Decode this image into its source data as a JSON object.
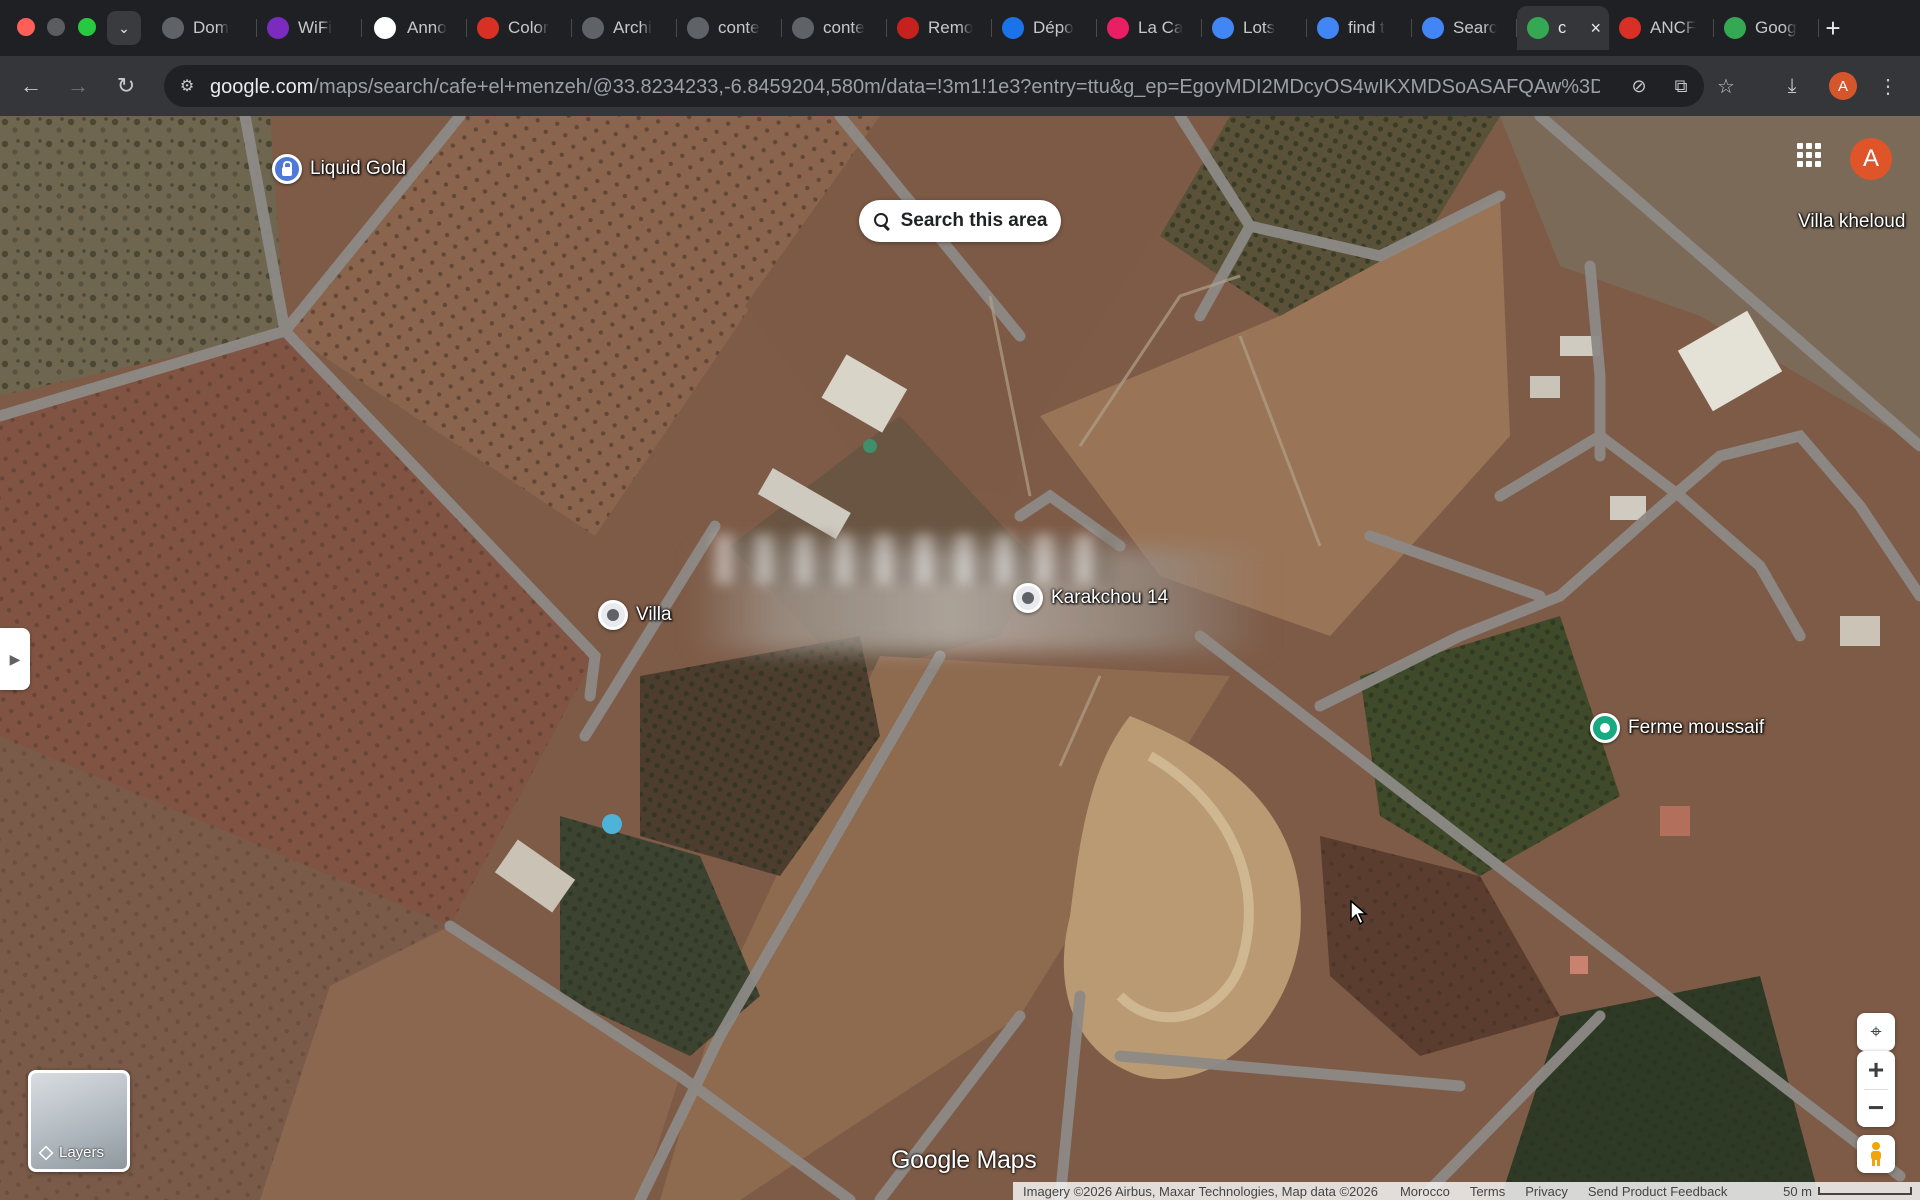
{
  "browser": {
    "tabs": [
      {
        "title": "Dom",
        "icon": "globe-icon",
        "color": "#5f6368"
      },
      {
        "title": "WiFi",
        "icon": "wifi-app-icon",
        "color": "#7b2cbf"
      },
      {
        "title": "Anno",
        "icon": "openai-icon",
        "color": "#ffffff"
      },
      {
        "title": "Color",
        "icon": "color-app-icon",
        "color": "#d93025"
      },
      {
        "title": "Archi",
        "icon": "archi-icon",
        "color": "#5f6368"
      },
      {
        "title": "conte",
        "icon": "globe-icon",
        "color": "#5f6368"
      },
      {
        "title": "conte",
        "icon": "globe-icon",
        "color": "#5f6368"
      },
      {
        "title": "Remo",
        "icon": "remove-bg-icon",
        "color": "#c5221f"
      },
      {
        "title": "Dépo",
        "icon": "cube-icon",
        "color": "#1a73e8"
      },
      {
        "title": "La Ca",
        "icon": "shape-icon",
        "color": "#e91e63"
      },
      {
        "title": "Lots",
        "icon": "google-icon",
        "color": "#4285f4"
      },
      {
        "title": "find t",
        "icon": "google-icon",
        "color": "#4285f4"
      },
      {
        "title": "Searc",
        "icon": "google-icon",
        "color": "#4285f4"
      },
      {
        "title": "c",
        "icon": "maps-pin-icon",
        "color": "#34a853",
        "active": true
      },
      {
        "title": "ANCF",
        "icon": "ancfcc-icon",
        "color": "#d93025"
      },
      {
        "title": "Goog",
        "icon": "maps-pin-icon",
        "color": "#34a853"
      }
    ],
    "url_host": "google.com",
    "url_path": "/maps/search/cafe+el+menzeh/@33.8234233,-6.8459204,580m/data=!3m1!1e3?entry=ttu&g_ep=EgoyMDI2MDcyOS4wIKXMDSoASAFQAw%3D...",
    "profile_initial": "A"
  },
  "map": {
    "search_area_label": "Search this area",
    "places": {
      "liquid_gold": "Liquid Gold",
      "villa_kheloud": "Villa kheloud",
      "villa": "Villa",
      "karakchou": "Karakchou 14",
      "ferme": "Ferme moussaif"
    },
    "account_initial": "A",
    "layers_label": "Layers",
    "logo_google": "Google",
    "logo_maps": "Maps",
    "footer": {
      "imagery": "Imagery ©2026 Airbus, Maxar Technologies, Map data ©2026",
      "country": "Morocco",
      "terms": "Terms",
      "privacy": "Privacy",
      "feedback": "Send Product Feedback",
      "scale": "50 m"
    }
  }
}
